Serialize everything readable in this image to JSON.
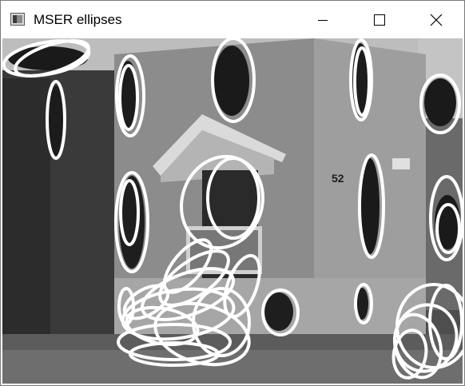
{
  "window": {
    "title": "MSER ellipses",
    "icon": "image-app-icon",
    "controls": {
      "minimize_icon": "minimize-icon",
      "maximize_icon": "maximize-icon",
      "close_icon": "close-icon"
    }
  },
  "image": {
    "subject": "grayscale house photo with MSER region ellipses overlaid in white",
    "house_number": "52",
    "ellipse_color": "#ffffff"
  }
}
